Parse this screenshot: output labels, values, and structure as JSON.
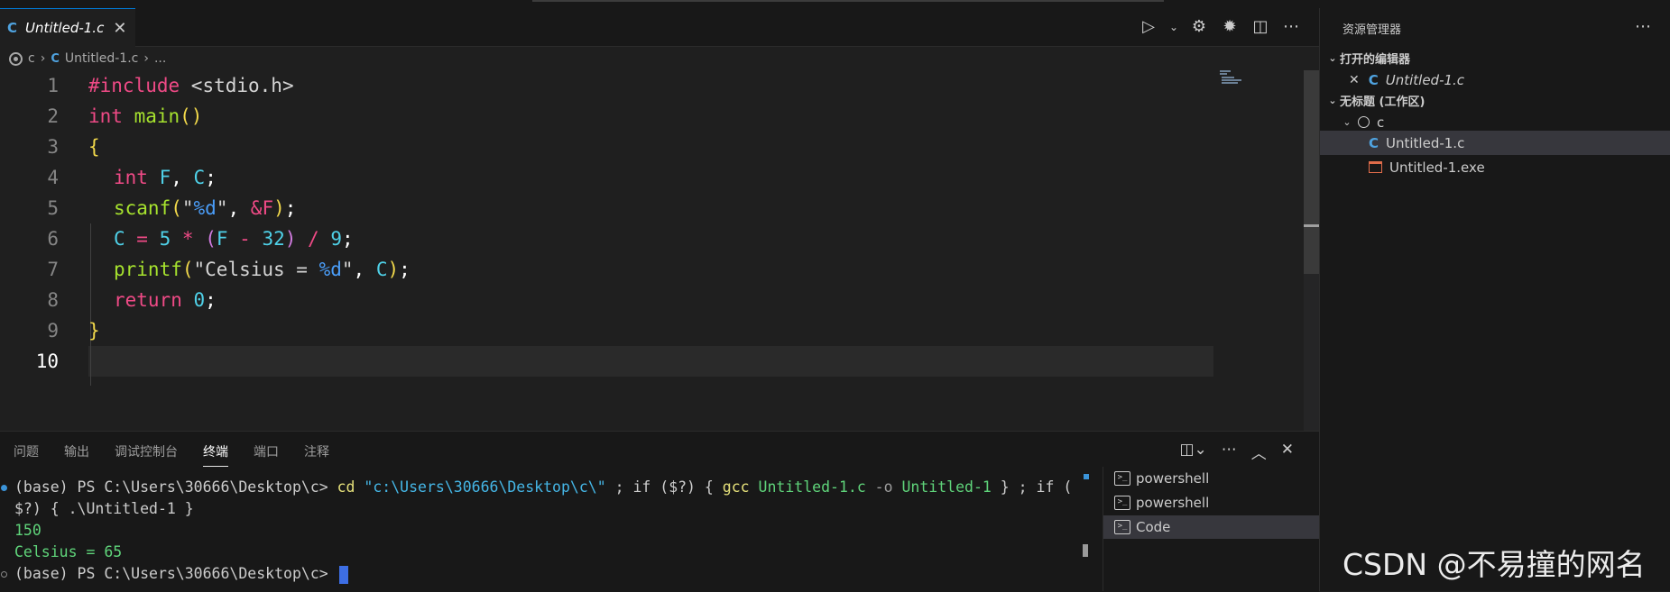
{
  "editor": {
    "tab_title": "Untitled-1.c",
    "tab_icon": "C",
    "close_glyph": "✕",
    "breadcrumb": [
      "c",
      "Untitled-1.c",
      "..."
    ],
    "line_numbers": [
      "1",
      "2",
      "3",
      "4",
      "5",
      "6",
      "7",
      "8",
      "9",
      "10"
    ],
    "code": {
      "l1": {
        "a": "#include",
        "b": " <stdio.h>"
      },
      "l2": {
        "a": "int",
        "b": " main",
        "c": "()"
      },
      "l3": {
        "a": "{"
      },
      "l4": {
        "a": "int",
        "b": " F",
        "c": ",",
        "d": " C",
        "e": ";"
      },
      "l5": {
        "a": "scanf",
        "b": "(",
        "c": "\"",
        "d": "%d",
        "e": "\"",
        "f": ", ",
        "g": "&",
        "h": "F",
        "i": ")",
        "j": ";"
      },
      "l6": {
        "a": "C",
        "b": " = ",
        "c": "5",
        "d": " * ",
        "e": "(",
        "f": "F",
        "g": " - ",
        "h": "32",
        "i": ")",
        "j": " / ",
        "k": "9",
        "l": ";"
      },
      "l7": {
        "a": "printf",
        "b": "(",
        "c": "\"Celsius = ",
        "d": "%d",
        "e": "\"",
        "f": ", ",
        "g": "C",
        "h": ")",
        "i": ";"
      },
      "l8": {
        "a": "return",
        "b": " 0",
        "c": ";"
      },
      "l9": {
        "a": "}"
      }
    }
  },
  "panel": {
    "tabs": [
      "问题",
      "输出",
      "调试控制台",
      "终端",
      "端口",
      "注释"
    ],
    "active_tab": "终端",
    "terminal": {
      "l1_prompt": "(base) PS C:\\Users\\30666\\Desktop\\c> ",
      "l1_cd": "cd",
      "l1_path": " \"c:\\Users\\30666\\Desktop\\c\\\"",
      "l1_mid": " ; if ($?) { ",
      "l1_gcc": "gcc",
      "l1_src": " Untitled-1.c",
      "l1_flag": " -o",
      "l1_out": " Untitled-1",
      "l1_end": " } ; if (",
      "l2": "$?) { .\\Untitled-1 }",
      "l3": "150",
      "l4": "Celsius = 65",
      "l5_prompt": "(base) PS C:\\Users\\30666\\Desktop\\c> "
    },
    "terminal_list": [
      "powershell",
      "powershell",
      "Code"
    ],
    "terminal_list_selected": "Code"
  },
  "explorer": {
    "title": "资源管理器",
    "open_editors_label": "打开的编辑器",
    "open_editor_file": "Untitled-1.c",
    "workspace_label": "无标题 (工作区)",
    "folder": "c",
    "files": [
      "Untitled-1.c",
      "Untitled-1.exe"
    ],
    "selected_file": "Untitled-1.c"
  },
  "watermark": "CSDN @不易撞的网名",
  "icons": {
    "run": "play-icon",
    "settings": "gear-icon",
    "debug": "bug-icon",
    "split": "split-editor-icon",
    "more": "ellipsis-icon"
  },
  "colors": {
    "accent": "#0078d4",
    "c_icon": "#4fa3e0",
    "exe_icon": "#e06c4a",
    "cursor": "#3d6ee4"
  }
}
